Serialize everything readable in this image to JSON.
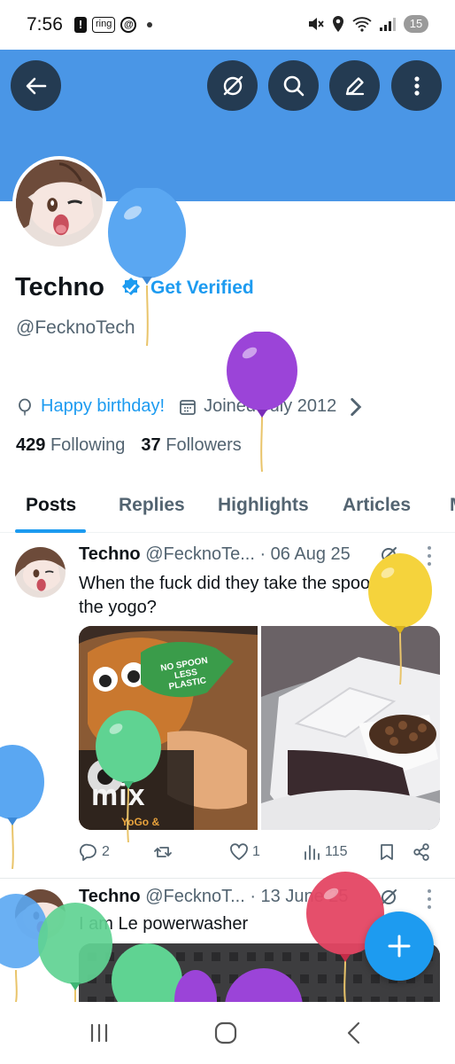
{
  "status_bar": {
    "time": "7:56",
    "alert_icon": "!",
    "ring_label": "ring",
    "at_icon": "@",
    "battery_level": "15"
  },
  "header": {
    "back_icon": "arrow-left-icon",
    "grok_icon": "grok-slash-circle-icon",
    "search_icon": "search-icon",
    "edit_icon": "pencil-icon",
    "more_icon": "vertical-dots-icon",
    "banner_color": "#4a96e6"
  },
  "profile": {
    "display_name": "Techno",
    "get_verified": "Get Verified",
    "handle": "@FecknoTech",
    "birthday_text": "Happy birthday!",
    "joined_text": "Joined July 2012",
    "following_count": "429",
    "following_label": "Following",
    "followers_count": "37",
    "followers_label": "Followers"
  },
  "tabs": [
    {
      "label": "Posts",
      "active": true
    },
    {
      "label": "Replies",
      "active": false
    },
    {
      "label": "Highlights",
      "active": false
    },
    {
      "label": "Articles",
      "active": false
    },
    {
      "label": "M",
      "active": false
    }
  ],
  "posts": [
    {
      "author": "Techno",
      "handle": "@FecknoTe...",
      "date": "· 06 Aug 25",
      "text": "When the fuck did they take the spoon out of the yogo?",
      "image_1_text": "NO SPOON LESS PLASTIC",
      "image_1_word": "mix",
      "image_1_sub": "YoGo &",
      "replies": "2",
      "reposts": "",
      "likes": "1",
      "views": "115"
    },
    {
      "author": "Techno",
      "handle": "@FecknoT...",
      "date": "· 13 June 25",
      "text": "I am Le powerwasher"
    }
  ],
  "colors": {
    "accent": "#1d9bf0",
    "secondary_text": "#536471",
    "balloon_blue": "#5aa7f2",
    "balloon_purple": "#9b44d8",
    "balloon_yellow": "#f5d33c",
    "balloon_green": "#5fd392",
    "balloon_red": "#e44663"
  }
}
